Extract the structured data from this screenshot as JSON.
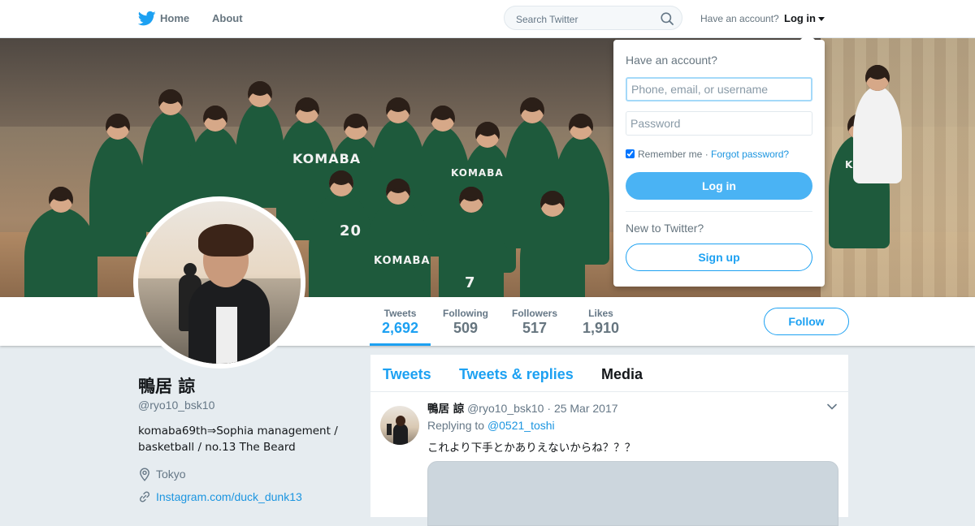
{
  "header": {
    "home_label": "Home",
    "about_label": "About",
    "search_placeholder": "Search Twitter",
    "have_account_text": "Have an account?",
    "login_label": "Log in",
    "icons": {
      "logo": "twitter-bird-icon",
      "search": "search-icon",
      "caret": "caret-down-icon"
    },
    "brand_color": "#1da1f2"
  },
  "login_dropdown": {
    "heading": "Have an account?",
    "username_placeholder": "Phone, email, or username",
    "password_placeholder": "Password",
    "remember_label": "Remember me",
    "separator": "·",
    "forgot_label": "Forgot password?",
    "remember_checked": true,
    "login_button": "Log in",
    "new_text": "New to Twitter?",
    "signup_button": "Sign up"
  },
  "banner": {
    "jersey_labels": [
      "KOMABA",
      "KOMABA",
      "KOMABA",
      "20",
      "7",
      "KOMABA"
    ]
  },
  "profile": {
    "name": "鴨居 諒",
    "screen_name": "@ryo10_bsk10",
    "bio_line1": "komaba69th⇒Sophia management /",
    "bio_line2": "basketball / no.13 The Beard",
    "location": "Tokyo",
    "website": "Instagram.com/duck_dunk13",
    "icons": {
      "location": "location-pin-icon",
      "link": "link-icon"
    }
  },
  "stats": [
    {
      "label": "Tweets",
      "value": "2,692",
      "active": true
    },
    {
      "label": "Following",
      "value": "509",
      "active": false
    },
    {
      "label": "Followers",
      "value": "517",
      "active": false
    },
    {
      "label": "Likes",
      "value": "1,910",
      "active": false
    }
  ],
  "follow_button": "Follow",
  "timeline": {
    "tabs": [
      {
        "label": "Tweets",
        "current": false
      },
      {
        "label": "Tweets & replies",
        "current": false
      },
      {
        "label": "Media",
        "current": true
      }
    ],
    "tweet": {
      "fullname": "鴨居 諒",
      "username": "@ryo10_bsk10",
      "separator": "·",
      "date": "25 Mar 2017",
      "replying_label": "Replying to",
      "replying_to": "@0521_toshi",
      "text": "これより下手とかありえないからね？？？"
    }
  }
}
